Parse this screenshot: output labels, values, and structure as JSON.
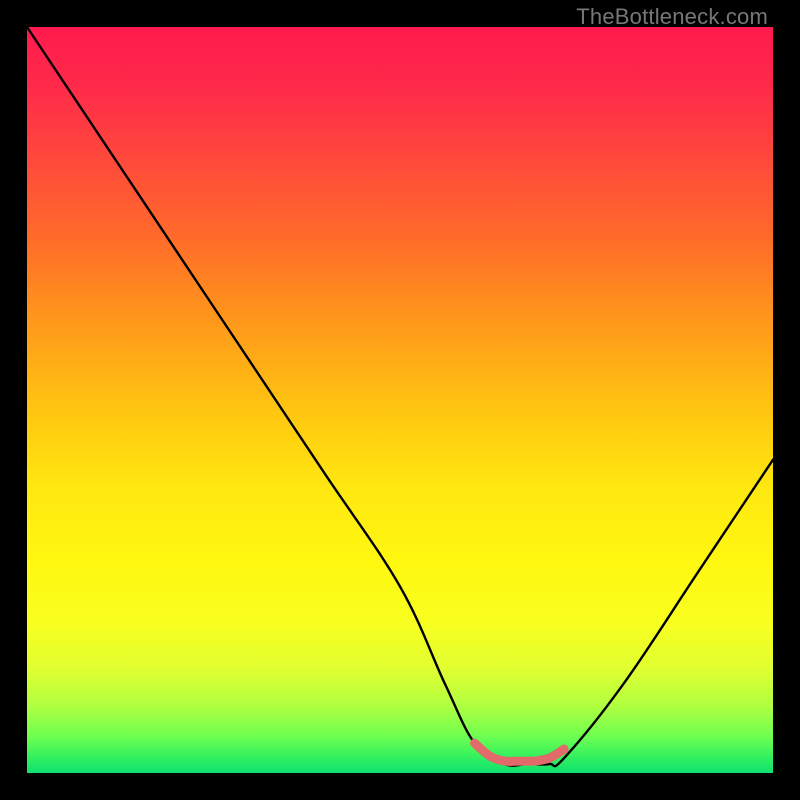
{
  "attribution": "TheBottleneck.com",
  "chart_data": {
    "type": "line",
    "title": "",
    "xlabel": "",
    "ylabel": "",
    "xlim": [
      0,
      100
    ],
    "ylim": [
      0,
      100
    ],
    "background_gradient": {
      "top": "#ff1a4d",
      "middle": "#ffe810",
      "bottom": "#10e070"
    },
    "series": [
      {
        "name": "main-curve",
        "color": "#000000",
        "x": [
          0,
          10,
          20,
          30,
          40,
          50,
          56,
          60,
          64,
          67,
          70,
          72,
          80,
          90,
          100
        ],
        "values": [
          100,
          85,
          70,
          55,
          40,
          25,
          12,
          4,
          1.2,
          1.2,
          1.2,
          2,
          12,
          27,
          42
        ]
      },
      {
        "name": "highlight-segment",
        "color": "#e26a6a",
        "x": [
          60,
          62,
          64,
          66,
          68,
          70,
          72
        ],
        "values": [
          4,
          2.3,
          1.6,
          1.6,
          1.6,
          2.0,
          3.2
        ]
      }
    ]
  }
}
